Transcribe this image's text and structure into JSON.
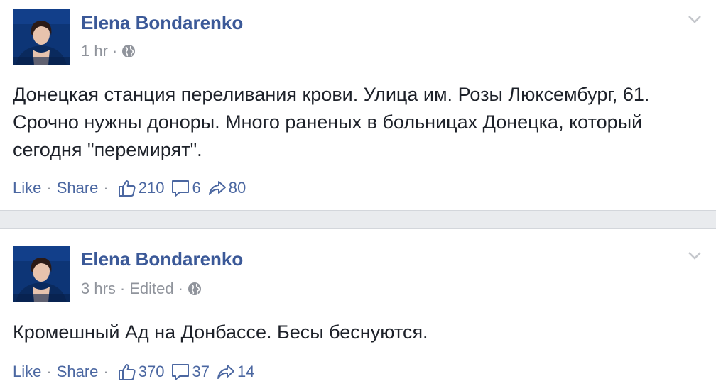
{
  "posts": [
    {
      "author": "Elena Bondarenko",
      "time": "1 hr",
      "edited": "",
      "text": "Донецкая станция переливания крови. Улица им. Розы Люксембург, 61. Срочно нужны доноры. Много раненых в больницах Донецка, который сегодня \"перемирят\".",
      "like_label": "Like",
      "share_label": "Share",
      "likes": "210",
      "comments": "6",
      "shares": "80"
    },
    {
      "author": "Elena Bondarenko",
      "time": "3 hrs",
      "edited": "Edited",
      "text": "Кромешный Ад на Донбассе. Бесы беснуются.",
      "like_label": "Like",
      "share_label": "Share",
      "likes": "370",
      "comments": "37",
      "shares": "14"
    }
  ],
  "icons": {
    "privacy": "globe-icon",
    "options": "chevron-down-icon",
    "like": "thumbs-up-icon",
    "comment": "comment-icon",
    "share": "share-arrow-icon"
  },
  "colors": {
    "link": "#3b5998",
    "action": "#4b67a1",
    "meta": "#90949c",
    "text": "#1d2129",
    "background": "#e9ebee"
  }
}
